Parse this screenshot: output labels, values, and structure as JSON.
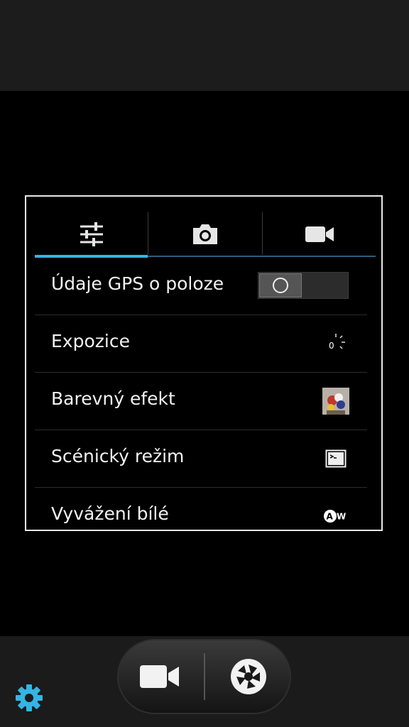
{
  "settings": {
    "tabs": [
      {
        "icon": "sliders-icon",
        "active": true
      },
      {
        "icon": "camera-icon",
        "active": false
      },
      {
        "icon": "video-camera-icon",
        "active": false
      }
    ],
    "rows": [
      {
        "label": "Údaje GPS o poloze",
        "control": "toggle",
        "toggle_on": false
      },
      {
        "label": "Expozice",
        "icon": "exposure-icon",
        "value": "0"
      },
      {
        "label": "Barevný efekt",
        "icon": "color-effect-thumbnail"
      },
      {
        "label": "Scénický režim",
        "icon": "scene-mode-icon"
      },
      {
        "label": "Vyvážení bílé",
        "icon": "white-balance-auto-icon",
        "value": "AW"
      }
    ]
  },
  "controls": {
    "video_button_icon": "video-camera-icon",
    "shutter_button_icon": "shutter-icon",
    "settings_icon": "gear-icon"
  },
  "colors": {
    "accent": "#33b5e5",
    "gear": "#33b5e5"
  }
}
